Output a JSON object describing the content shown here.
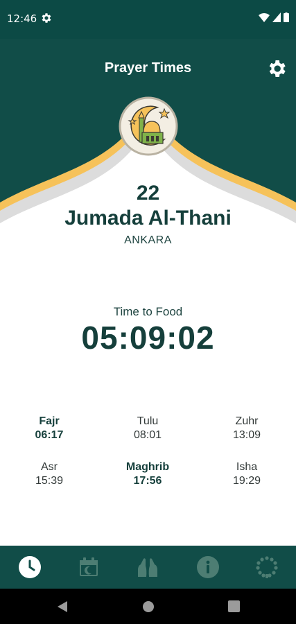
{
  "status_bar": {
    "time": "12:46"
  },
  "app_bar": {
    "title": "Prayer Times"
  },
  "hijri_date": {
    "day": "22",
    "month": "Jumada Al-Thani"
  },
  "location": {
    "city": "ANKARA"
  },
  "countdown": {
    "label": "Time to Food",
    "value": "05:09:02"
  },
  "prayers": [
    {
      "name": "Fajr",
      "time": "06:17",
      "highlighted": true
    },
    {
      "name": "Tulu",
      "time": "08:01",
      "highlighted": false
    },
    {
      "name": "Zuhr",
      "time": "13:09",
      "highlighted": false
    },
    {
      "name": "Asr",
      "time": "15:39",
      "highlighted": false
    },
    {
      "name": "Maghrib",
      "time": "17:56",
      "highlighted": true
    },
    {
      "name": "Isha",
      "time": "19:29",
      "highlighted": false
    }
  ],
  "bottom_nav": {
    "items": [
      {
        "icon": "clock-icon",
        "active": true
      },
      {
        "icon": "calendar-icon",
        "active": false
      },
      {
        "icon": "praying-hands-icon",
        "active": false
      },
      {
        "icon": "info-icon",
        "active": false
      },
      {
        "icon": "prayer-beads-icon",
        "active": false
      }
    ]
  },
  "colors": {
    "primary": "#114d48",
    "status_bar": "#0c4a45",
    "accent_gold": "#f6c25a",
    "text_dark": "#153f3b",
    "nav_inactive": "#4d7d73",
    "nav_active": "#ffffff"
  }
}
